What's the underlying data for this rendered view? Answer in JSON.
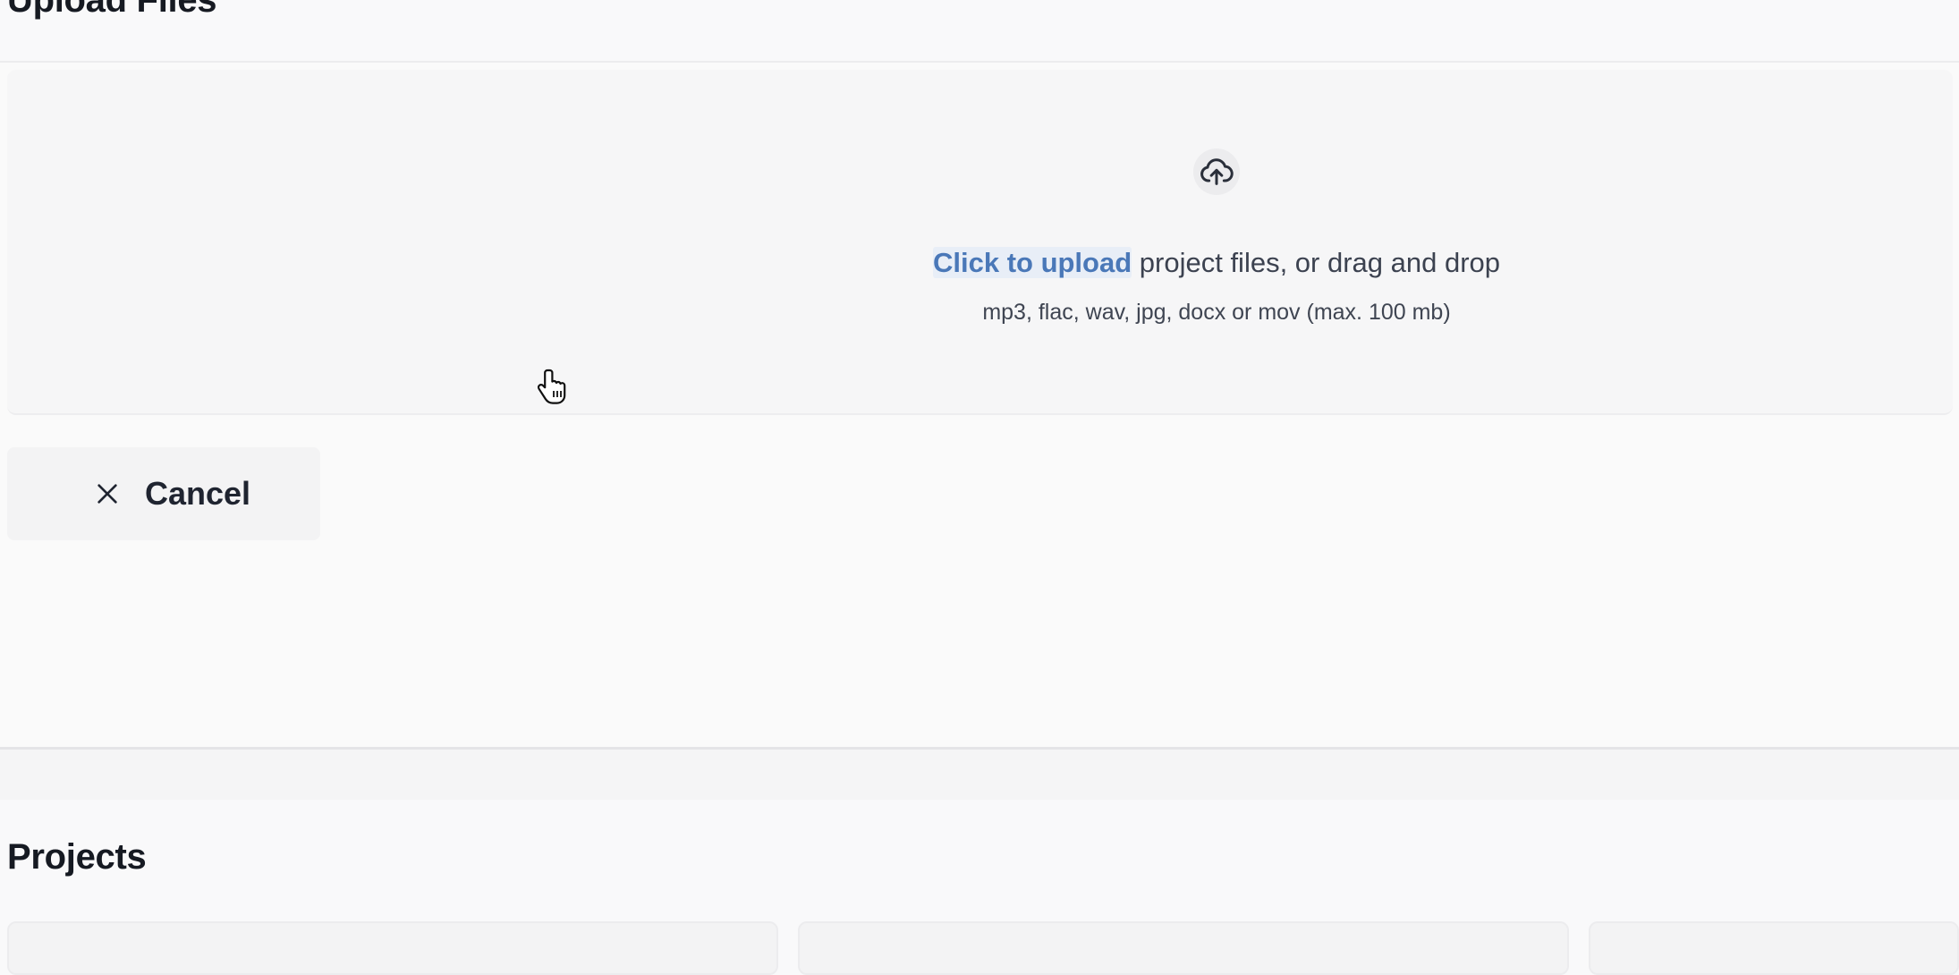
{
  "upload_section": {
    "title": "Upload Files",
    "dropzone": {
      "icon": "cloud-upload-icon",
      "link_text": "Click to upload",
      "instruction_text": " project files, or drag and drop",
      "hint": "mp3, flac, wav, jpg, docx or mov (max. 100 mb)"
    },
    "cancel_button": {
      "icon": "close-icon",
      "label": "Cancel"
    }
  },
  "projects_section": {
    "title": "Projects",
    "cards": [
      {
        "name": "project-card-1"
      },
      {
        "name": "project-card-2"
      },
      {
        "name": "project-card-3"
      }
    ]
  },
  "colors": {
    "background": "#f9f9fa",
    "link": "#4a78b8",
    "text_primary": "#1f2430",
    "text_secondary": "#3c4250"
  }
}
